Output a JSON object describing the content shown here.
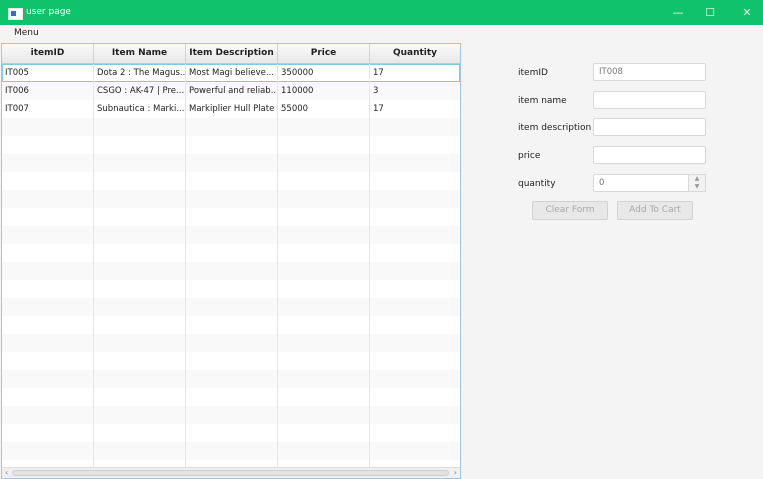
{
  "window": {
    "title": "user page",
    "minimize": "—",
    "maximize": "☐",
    "close": "✕"
  },
  "menubar": {
    "menu": "Menu"
  },
  "table": {
    "columns": [
      "itemID",
      "Item Name",
      "Item Description",
      "Price",
      "Quantity"
    ],
    "rows": [
      [
        "IT005",
        "Dota 2 : The Magus...",
        "Most Magi believe...",
        "350000",
        "17"
      ],
      [
        "IT006",
        "CSGO : AK-47 | Pre...",
        "Powerful and reliab...",
        "110000",
        "3"
      ],
      [
        "IT007",
        "Subnautica : Marki...",
        "Markiplier Hull Plate",
        "55000",
        "17"
      ]
    ],
    "selected_row": 0
  },
  "form": {
    "itemid_label": "itemID",
    "itemid_value": "IT008",
    "item_name_label": "item name",
    "item_desc_label": "item description",
    "price_label": "price",
    "quantity_label": "quantity",
    "quantity_value": "0",
    "clear_button": "Clear Form",
    "cart_button": "Add To Cart"
  }
}
